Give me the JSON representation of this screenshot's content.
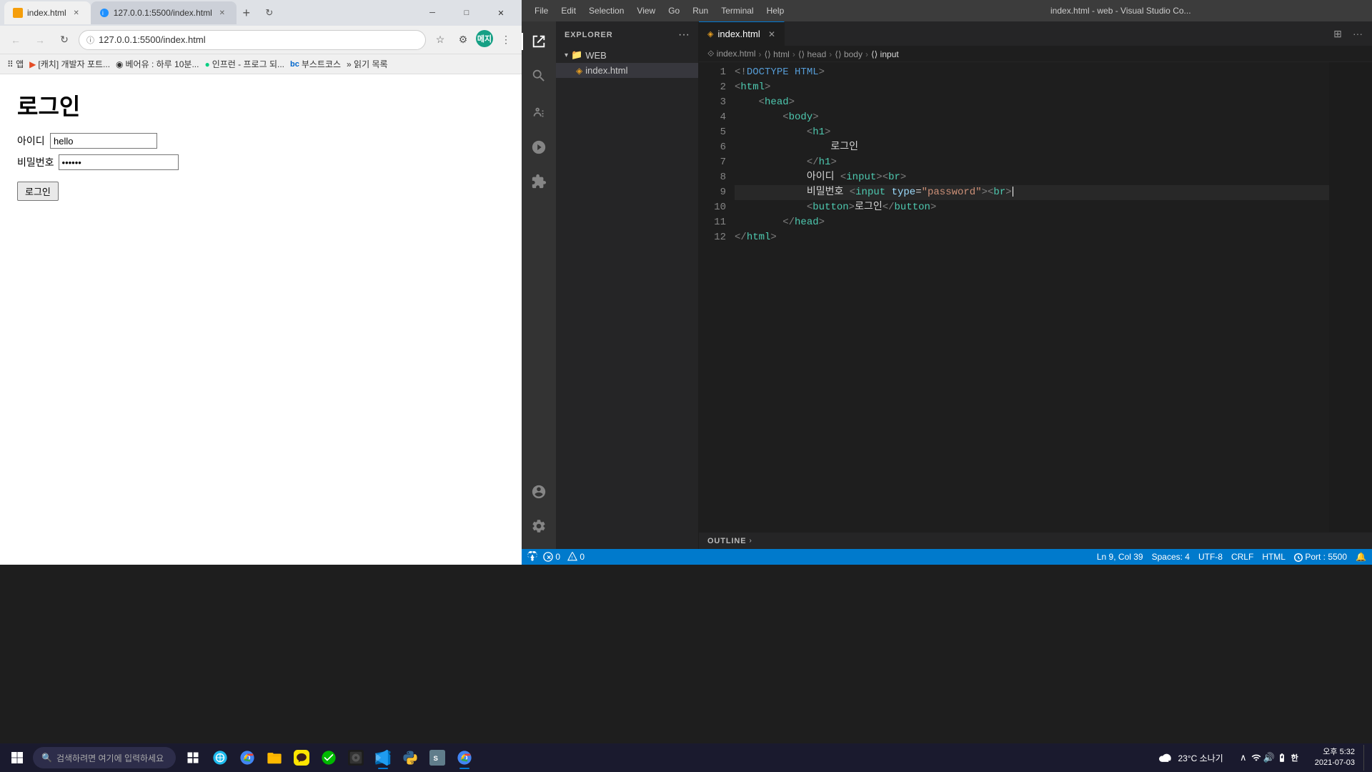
{
  "browser": {
    "tab1": {
      "label": "index.html",
      "favicon": "orange"
    },
    "tab2": {
      "label": "127.0.0.1:5500/index.html",
      "favicon": "blue"
    },
    "address": "127.0.0.1:5500/index.html",
    "bookmarks": [
      {
        "label": "앱"
      },
      {
        "label": "[캐치] 개발자 포트..."
      },
      {
        "label": "베어유 : 하루 10분..."
      },
      {
        "label": "인프런 - 프로그 되..."
      },
      {
        "label": "bc 부스트코스"
      },
      {
        "label": "» 읽기 목록"
      }
    ],
    "page": {
      "title": "로그인",
      "id_label": "아이디",
      "id_value": "hello",
      "pw_label": "비밀번호",
      "pw_value": "••••••",
      "btn_label": "로그인"
    }
  },
  "vscode": {
    "title": "index.html - web - Visual Studio Co...",
    "menu": [
      "File",
      "Edit",
      "Selection",
      "View",
      "Go",
      "Run",
      "Terminal",
      "Help"
    ],
    "tab": {
      "label": "index.html",
      "modified": false
    },
    "breadcrumb": [
      "index.html",
      "html",
      "head",
      "body",
      "input"
    ],
    "explorer": {
      "title": "EXPLORER",
      "root": "WEB",
      "files": [
        "index.html"
      ]
    },
    "code": {
      "lines": [
        {
          "n": 1,
          "text": "<!DOCTYPE HTML>"
        },
        {
          "n": 2,
          "text": "<html>"
        },
        {
          "n": 3,
          "text": "    <head>"
        },
        {
          "n": 4,
          "text": "        <body>"
        },
        {
          "n": 5,
          "text": "            <h1>"
        },
        {
          "n": 6,
          "text": "                로그인"
        },
        {
          "n": 7,
          "text": "            </h1>"
        },
        {
          "n": 8,
          "text": "            아이디 <input><br>"
        },
        {
          "n": 9,
          "text": "            비밀번호 <input type=\"password\"><br>",
          "highlight": true
        },
        {
          "n": 10,
          "text": "            <button>로그인</button>"
        },
        {
          "n": 11,
          "text": "        </head>"
        },
        {
          "n": 12,
          "text": "</html>"
        }
      ]
    },
    "statusbar": {
      "errors": "0",
      "warnings": "0",
      "ln": "Ln 9",
      "col": "Col 39",
      "spaces": "Spaces: 4",
      "encoding": "UTF-8",
      "eol": "CRLF",
      "lang": "HTML",
      "port": "Port : 5500"
    },
    "outline": "OUTLINE"
  },
  "taskbar": {
    "search_placeholder": "검색하려면 여기에 입력하세요",
    "weather": "23°C 소나기",
    "time": "오후 5:32",
    "date": "2021-07-03",
    "apps": [
      {
        "name": "windows-start"
      },
      {
        "name": "search"
      },
      {
        "name": "file-explorer"
      },
      {
        "name": "edge-browser"
      },
      {
        "name": "chrome"
      },
      {
        "name": "kakao"
      },
      {
        "name": "firefox"
      },
      {
        "name": "ie"
      },
      {
        "name": "messenger"
      },
      {
        "name": "vscode",
        "active": true
      },
      {
        "name": "python"
      },
      {
        "name": "unknown"
      },
      {
        "name": "chrome2",
        "active": true
      }
    ]
  }
}
